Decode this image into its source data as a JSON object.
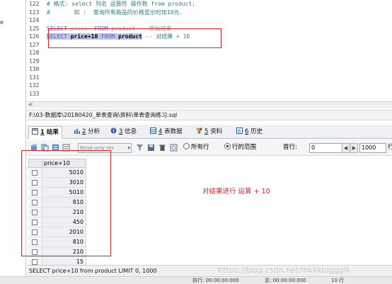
{
  "left_panel": {
    "label": "e"
  },
  "editor": {
    "lines": [
      {
        "num": "122",
        "text": "# 格式: select 列名 运算符 操作数 from product;"
      },
      {
        "num": "123",
        "text": "#       如 :  查询所有商品的价格显示时加10元."
      },
      {
        "num": "124",
        "text": ""
      },
      {
        "num": "125",
        "text_kw1": "SELECT",
        "text_mid": " price  ",
        "text_kw2": "FROM",
        "text_end": " product    原始结果"
      },
      {
        "num": "126",
        "sel_kw1": "SELECT",
        "sel_mid": " price+10 ",
        "sel_kw2": "FROM",
        "sel_end": " product",
        "comment": " -- 对结果 + 10"
      },
      {
        "num": "127",
        "text": ""
      },
      {
        "num": "128",
        "text": ""
      },
      {
        "num": "129",
        "text": ""
      },
      {
        "num": "130",
        "text": ""
      },
      {
        "num": "131",
        "text": ""
      },
      {
        "num": "132",
        "text": ""
      },
      {
        "num": "133",
        "text": ""
      }
    ]
  },
  "path_bar": "F:\\03-数据库\\20180420_单表查询\\资料\\单表查询练习.sql",
  "tabs": [
    {
      "num": "1",
      "label": "结果",
      "icon": "result-grid-icon",
      "active": true
    },
    {
      "num": "2",
      "label": "分析",
      "icon": "profiler-icon",
      "active": false
    },
    {
      "num": "3",
      "label": "信息",
      "icon": "info-icon",
      "active": false
    },
    {
      "num": "4",
      "label": "表数据",
      "icon": "table-data-icon",
      "active": false
    },
    {
      "num": "5",
      "label": "资料",
      "icon": "info-color-icon",
      "active": false
    },
    {
      "num": "6",
      "label": "历史",
      "icon": "history-icon",
      "active": false
    }
  ],
  "toolbar": {
    "readonly_label": "Read-only res",
    "radio_all": "所有行",
    "radio_range": "行的范围",
    "first_row_label": "首行:",
    "first_row_value": "0",
    "row_count_value": "1000",
    "trailing_label": "行"
  },
  "grid": {
    "column": "price+10",
    "rows": [
      "5010",
      "3010",
      "5010",
      "810",
      "210",
      "450",
      "2010",
      "810",
      "210",
      "15"
    ]
  },
  "annotation": "对结果进行 运算  + 10",
  "status_text": "SELECT price+10 from product  LIMIT 0, 1000",
  "watermark": "https://blog.csdn.net/lnkkkblggglk",
  "bottom_strip": {
    "exec": "执行: 00:00:00:000",
    "total": "总: 00:00:00:000",
    "rows": "10 行"
  },
  "colors": {
    "annotation": "#e0262c",
    "selection": "#b9cbe4",
    "comment": "#2f7d7d",
    "keyword": "#5a5ad0"
  }
}
